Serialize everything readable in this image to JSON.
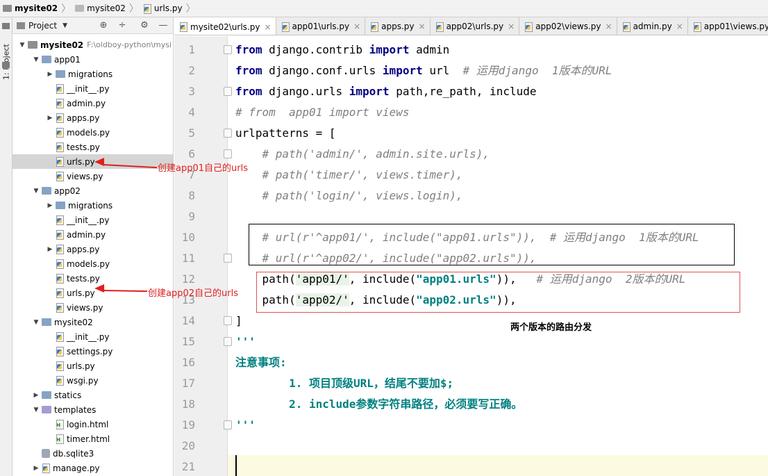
{
  "breadcrumb": {
    "project": "mysite02",
    "folder": "mysite02",
    "file": "urls.py"
  },
  "left_strip": {
    "label": "1: Project"
  },
  "project_panel": {
    "title": "Project",
    "tree": [
      {
        "label": "mysite02",
        "path": "F:\\oldboy-python\\mysi"
      },
      {
        "label": "app01"
      },
      {
        "label": "migrations"
      },
      {
        "label": "__init__.py"
      },
      {
        "label": "admin.py"
      },
      {
        "label": "apps.py"
      },
      {
        "label": "models.py"
      },
      {
        "label": "tests.py"
      },
      {
        "label": "urls.py"
      },
      {
        "label": "views.py"
      },
      {
        "label": "app02"
      },
      {
        "label": "migrations"
      },
      {
        "label": "__init__.py"
      },
      {
        "label": "admin.py"
      },
      {
        "label": "apps.py"
      },
      {
        "label": "models.py"
      },
      {
        "label": "tests.py"
      },
      {
        "label": "urls.py"
      },
      {
        "label": "views.py"
      },
      {
        "label": "mysite02"
      },
      {
        "label": "__init__.py"
      },
      {
        "label": "settings.py"
      },
      {
        "label": "urls.py"
      },
      {
        "label": "wsgi.py"
      },
      {
        "label": "statics"
      },
      {
        "label": "templates"
      },
      {
        "label": "login.html"
      },
      {
        "label": "timer.html"
      },
      {
        "label": "db.sqlite3"
      },
      {
        "label": "manage.py"
      }
    ]
  },
  "tabs": [
    "mysite02\\urls.py",
    "app01\\urls.py",
    "apps.py",
    "app02\\urls.py",
    "app02\\views.py",
    "admin.py",
    "app01\\views.py"
  ],
  "editor": {
    "line_numbers": [
      "1",
      "2",
      "3",
      "4",
      "5",
      "6",
      "7",
      "8",
      "9",
      "10",
      "11",
      "12",
      "13",
      "14",
      "15",
      "16",
      "17",
      "18",
      "19",
      "20",
      "21"
    ],
    "tok": {
      "from": "from",
      "import": "import",
      "l1_mod": " django.contrib ",
      "l1_name": " admin",
      "l2_mod": " django.conf.urls ",
      "l2_name": " url  ",
      "l2_cm": "# 运用django  1版本的URL",
      "l3_mod": " django.urls ",
      "l3_name": " path,",
      "l3_rest": "re_path, include",
      "l4": "# from  app01 import views",
      "l5": "urlpatterns = [",
      "l6": "    # path('admin/', admin.site.urls),",
      "l7": "    # path('timer/', views.timer),",
      "l8": "    # path('login/', views.login),",
      "l10": "    # url(r'^app01/', include(\"app01.urls\")),  # 运用django  1版本的URL",
      "l11": "    # url(r'^app02/', include(\"app02.urls\")),",
      "l12_a": "    path(",
      "l12_s": "'app01/'",
      "l12_b": ", include(",
      "l12_s2": "\"app01.urls\"",
      "l12_c": ")),   ",
      "l12_cm": "# 运用django  2版本的URL",
      "l13_a": "    path(",
      "l13_s": "'app02/'",
      "l13_b": ", include(",
      "l13_s2": "\"app02.urls\"",
      "l13_c": ")),",
      "l14": "]",
      "l15": "'''",
      "l16": "注意事项:",
      "l17": "        1. 项目顶级URL，结尾不要加$;",
      "l18": "        2. include参数字符串路径，必须要写正确。",
      "l19": "'''"
    },
    "caption": "两个版本的路由分发"
  },
  "annotations": {
    "a1": "创建app01自己的urls",
    "a2": "创建app02自己的urls"
  }
}
